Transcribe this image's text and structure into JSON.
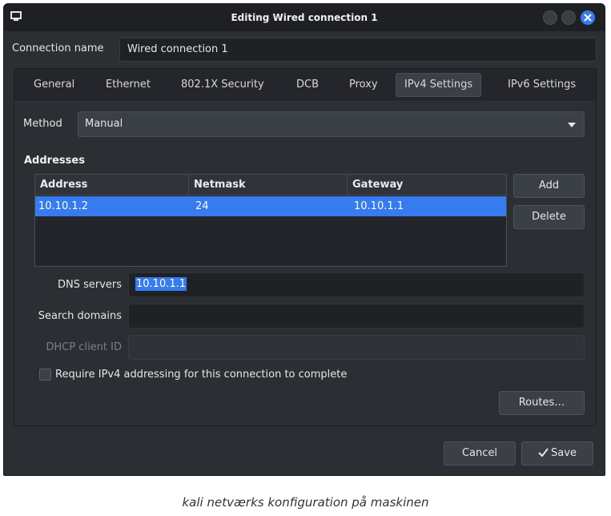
{
  "window": {
    "title": "Editing Wired connection 1"
  },
  "connection": {
    "label": "Connection name",
    "value": "Wired connection 1"
  },
  "tabs": [
    {
      "label": "General"
    },
    {
      "label": "Ethernet"
    },
    {
      "label": "802.1X Security"
    },
    {
      "label": "DCB"
    },
    {
      "label": "Proxy"
    },
    {
      "label": "IPv4 Settings",
      "active": true
    },
    {
      "label": "IPv6 Settings"
    }
  ],
  "ipv4": {
    "method_label": "Method",
    "method_value": "Manual",
    "addresses_heading": "Addresses",
    "columns": [
      "Address",
      "Netmask",
      "Gateway"
    ],
    "rows": [
      {
        "address": "10.10.1.2",
        "netmask": "24",
        "gateway": "10.10.1.1"
      }
    ],
    "add_label": "Add",
    "delete_label": "Delete",
    "dns_label": "DNS servers",
    "dns_value": "10.10.1.1",
    "search_label": "Search domains",
    "search_value": "",
    "dhcp_label": "DHCP client ID",
    "dhcp_value": "",
    "require_label": "Require IPv4 addressing for this connection to complete",
    "require_checked": false,
    "routes_label": "Routes…"
  },
  "footer": {
    "cancel_label": "Cancel",
    "save_label": "Save"
  },
  "caption": "kali netværks konfiguration på maskinen",
  "colors": {
    "accent": "#367bf0",
    "window_bg": "#2b2e33",
    "titlebar_bg": "#1e2024"
  }
}
